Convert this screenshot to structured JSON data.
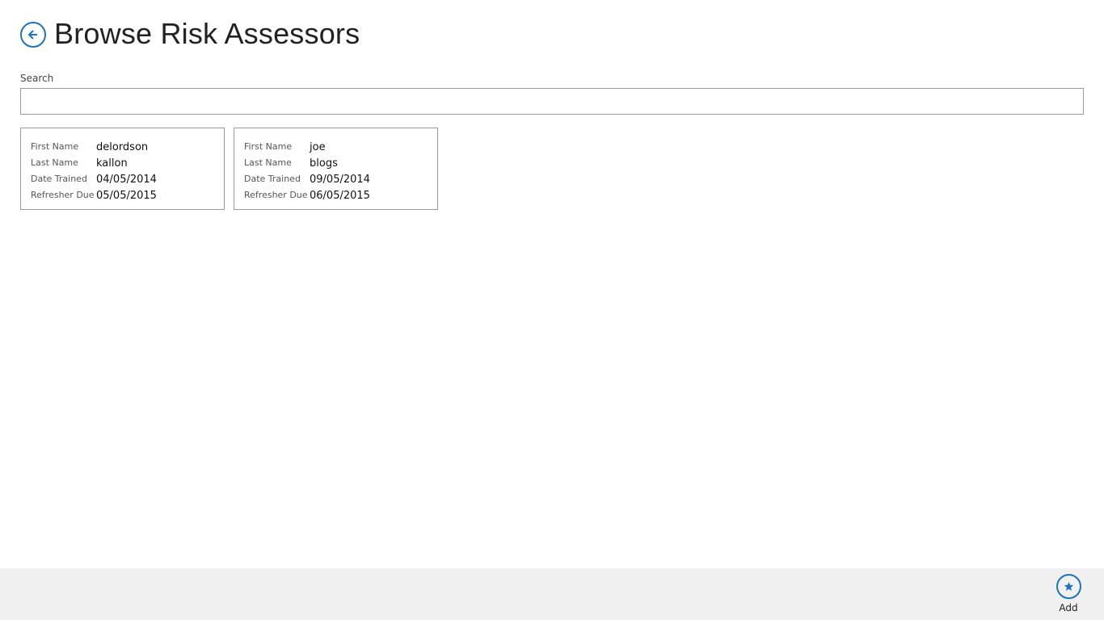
{
  "header": {
    "title": "Browse Risk Assessors",
    "back_icon": "back-arrow-icon"
  },
  "search": {
    "label": "Search",
    "value": "",
    "placeholder": ""
  },
  "cards": [
    {
      "first_name_label": "First Name",
      "first_name": "delordson",
      "last_name_label": "Last Name",
      "last_name": "kallon",
      "date_trained_label": "Date Trained",
      "date_trained": "04/05/2014",
      "refresher_due_label": "Refresher Due",
      "refresher_due": "05/05/2015"
    },
    {
      "first_name_label": "First Name",
      "first_name": "joe",
      "last_name_label": "Last Name",
      "last_name": "blogs",
      "date_trained_label": "Date Trained",
      "date_trained": "09/05/2014",
      "refresher_due_label": "Refresher Due",
      "refresher_due": "06/05/2015"
    }
  ],
  "app_bar": {
    "add_label": "Add",
    "add_icon": "star-icon"
  },
  "colors": {
    "accent": "#1e73be",
    "app_bar_bg": "#f0f0f0",
    "border": "#9a9a9a"
  }
}
